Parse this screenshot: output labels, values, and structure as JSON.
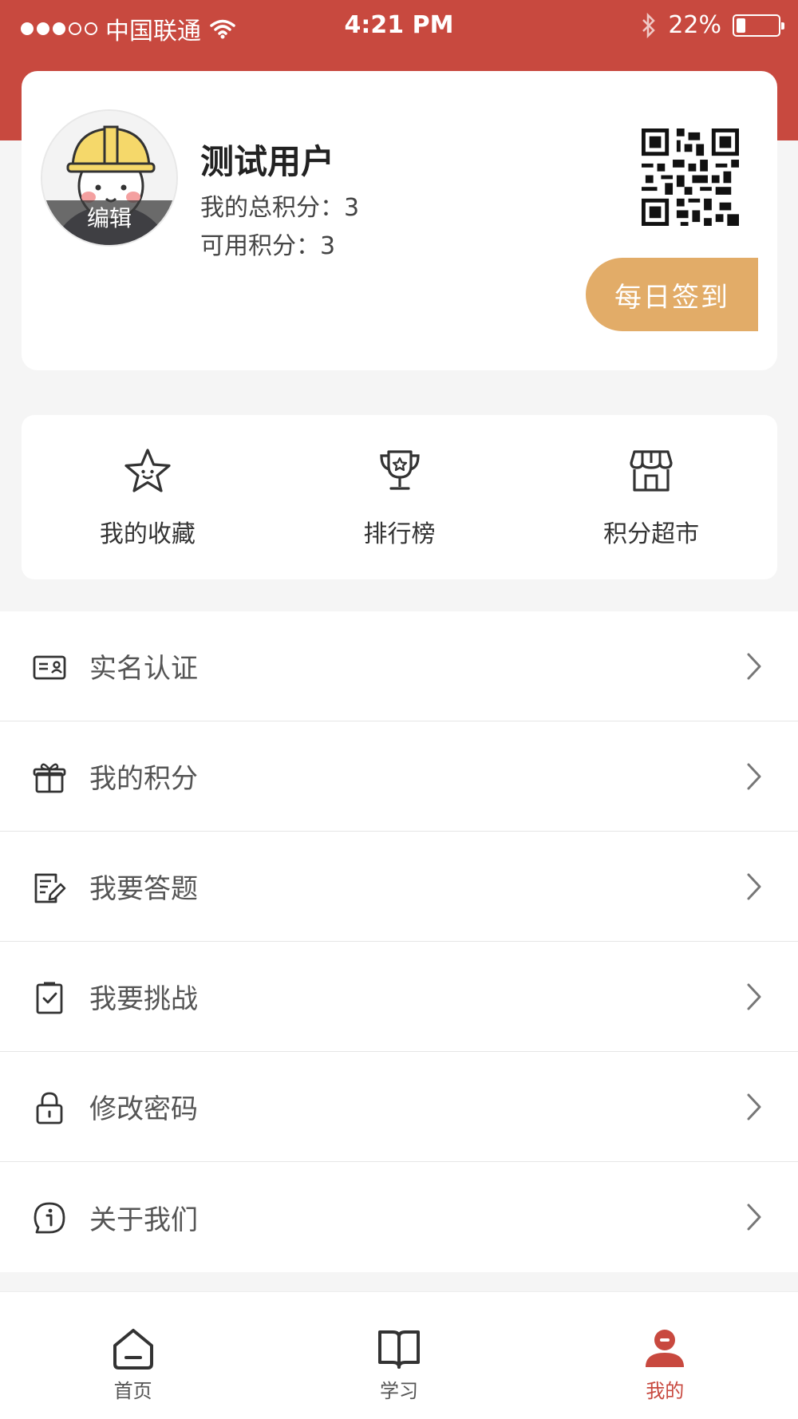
{
  "status_bar": {
    "carrier": "中国联通",
    "time": "4:21 PM",
    "battery": "22%",
    "battery_level": 0.22,
    "icons": [
      "wifi-icon",
      "bluetooth-icon",
      "battery-icon"
    ]
  },
  "profile": {
    "name": "测试用户",
    "total_points": "我的总积分：3",
    "available_points": "可用积分：3",
    "avatar_edit": "编辑",
    "checkin_label": "每日签到",
    "checkin_color": "#e2ac68"
  },
  "quick_links": [
    {
      "label": "我的收藏",
      "icon": "star-icon"
    },
    {
      "label": "排行榜",
      "icon": "trophy-icon"
    },
    {
      "label": "积分超市",
      "icon": "store-icon"
    }
  ],
  "menu": [
    {
      "label": "实名认证",
      "icon": "id-card-icon"
    },
    {
      "label": "我的积分",
      "icon": "gift-icon"
    },
    {
      "label": "我要答题",
      "icon": "edit-doc-icon"
    },
    {
      "label": "我要挑战",
      "icon": "checklist-icon"
    },
    {
      "label": "修改密码",
      "icon": "lock-icon"
    },
    {
      "label": "关于我们",
      "icon": "info-icon"
    }
  ],
  "tabs": [
    {
      "label": "首页",
      "icon": "home-icon",
      "active": false
    },
    {
      "label": "学习",
      "icon": "book-icon",
      "active": false
    },
    {
      "label": "我的",
      "icon": "user-icon",
      "active": true
    }
  ],
  "colors": {
    "brand": "#c8493f",
    "accent": "#e2ac68",
    "background": "#f5f5f5"
  }
}
